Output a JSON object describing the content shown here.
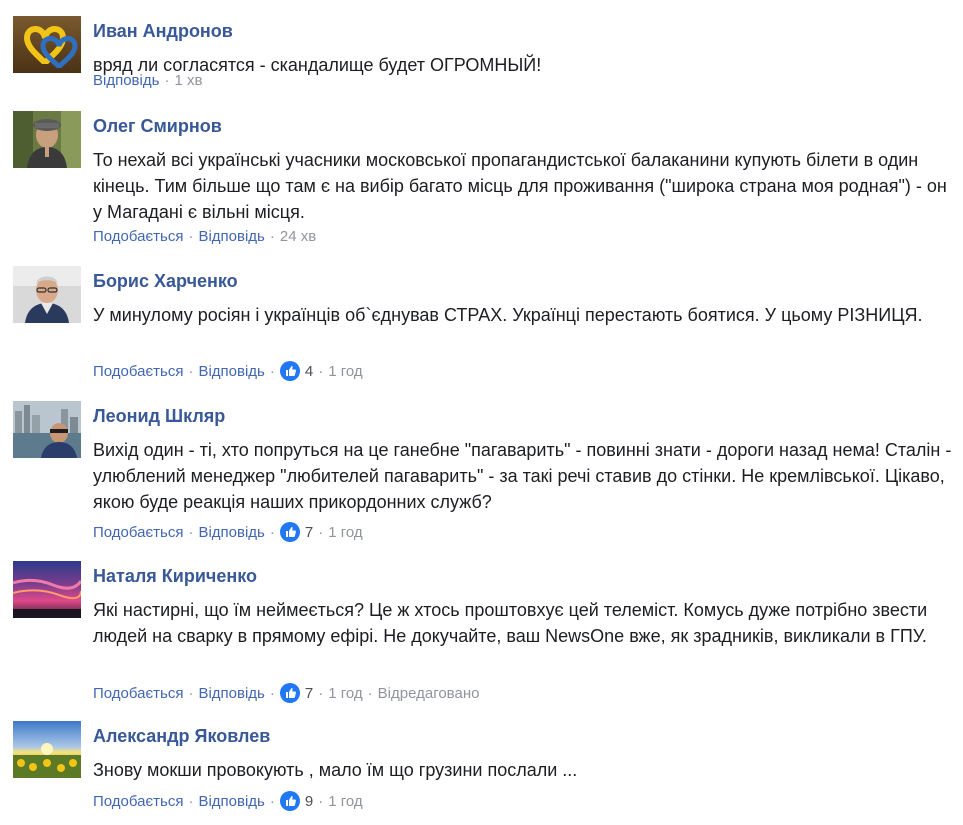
{
  "colors": {
    "author": "#385898",
    "link": "#4267b2",
    "meta": "#90949c",
    "text": "#1c1e21",
    "like_blue": "#2078f4"
  },
  "comments": [
    {
      "author": "Иван Андронов",
      "avatar_icon": "hearts-yellow-blue-avatar",
      "text": "вряд ли согласятся - скандалище будет ОГРОМНЫЙ!",
      "reply_label": "Відповідь",
      "time": "1 хв"
    },
    {
      "author": "Олег Смирнов",
      "avatar_icon": "man-in-cap-avatar",
      "text": "То нехай всі українські учасники московської пропагандистської балаканини купують білети в один кінець. Тим більше що там є на вибір багато місць для проживання (\"широка страна моя родная\") - он у Магадані є вільні місця.",
      "like_label": "Подобається",
      "reply_label": "Відповідь",
      "time": "24 хв"
    },
    {
      "author": "Борис Харченко",
      "avatar_icon": "man-portrait-avatar",
      "text": "У минулому росіян і українців об`єднував СТРАХ. Українці перестають боятися. У цьому РІЗНИЦЯ.",
      "like_label": "Подобається",
      "reply_label": "Відповідь",
      "likes": "4",
      "time": "1 год"
    },
    {
      "author": "Леонид Шкляр",
      "avatar_icon": "man-city-skyline-avatar",
      "text": "Вихід один - ті, хто попруться на це ганебне \"пагаварить\" - повинні знати - дороги назад нема! Сталін - улюблений менеджер \"любителей пагаварить\" - за такі речі ставив до стінки. Не кремлівської. Цікаво, якою буде реакція наших прикордонних служб?",
      "like_label": "Подобається",
      "reply_label": "Відповідь",
      "likes": "7",
      "time": "1 год"
    },
    {
      "author": "Наталя Кириченко",
      "avatar_icon": "pink-sunset-avatar",
      "text": "Які настирні, що їм неймеється? Це ж хтось проштовхує цей телеміст. Комусь дуже потрібно звести людей на сварку в прямому ефірі. Не докучайте, ваш NewsOne вже, як зрадників, викликали в ГПУ.",
      "like_label": "Подобається",
      "reply_label": "Відповідь",
      "likes": "7",
      "time": "1 год",
      "edited": "Відредаговано"
    },
    {
      "author": "Александр Яковлев",
      "avatar_icon": "sunflower-field-avatar",
      "text": "Знову мокши провокують , мало їм що грузини послали ...",
      "like_label": "Подобається",
      "reply_label": "Відповідь",
      "likes": "9",
      "time": "1 год"
    }
  ]
}
